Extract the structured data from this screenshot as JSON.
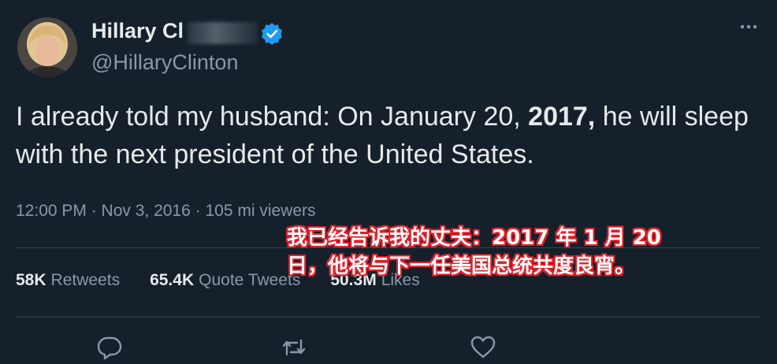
{
  "tweet": {
    "display_name": "Hillary Cl",
    "handle": "@HillaryClinton",
    "text_before": "I already told my husband: On January 20, ",
    "text_bold": "2017,",
    "text_after": " he will sleep with the next president of the United States.",
    "meta": "12:00 PM · Nov 3, 2016 · 105 mi viewers"
  },
  "stats": {
    "retweets_count": "58K",
    "retweets_label": "Retweets",
    "quotes_count": "65.4K",
    "quotes_label": "Quote Tweets",
    "likes_count": "50.3M",
    "likes_label": "Likes"
  },
  "caption": "我已经告诉我的丈夫：2017 年 1 月 20 日，他将与下一任美国总统共度良宵。",
  "icons": {
    "verified": "verified-badge-icon",
    "more": "more-icon",
    "reply": "reply-icon",
    "retweet": "retweet-icon",
    "like": "like-icon"
  },
  "colors": {
    "background": "#15202b",
    "text": "#e7e9ea",
    "secondary": "#8b98a5",
    "verified": "#1d9bf0",
    "caption_outline": "#e0202a"
  }
}
